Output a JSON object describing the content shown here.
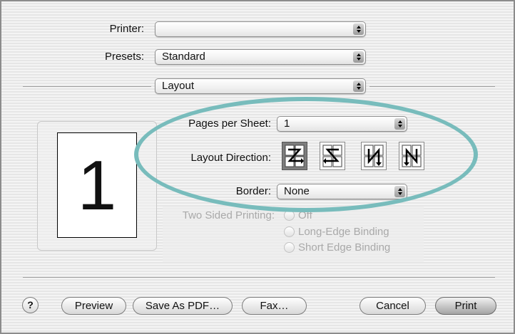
{
  "printer": {
    "label": "Printer:",
    "value": ""
  },
  "presets": {
    "label": "Presets:",
    "value": "Standard"
  },
  "panel_select": {
    "value": "Layout"
  },
  "preview": {
    "page_number": "1"
  },
  "layout": {
    "pages_per_sheet": {
      "label": "Pages per Sheet:",
      "value": "1"
    },
    "direction": {
      "label": "Layout Direction:",
      "options": [
        "z-order",
        "reverse-z-order",
        "n-order",
        "reverse-n-order"
      ],
      "selected_index": 0
    },
    "border": {
      "label": "Border:",
      "value": "None"
    }
  },
  "two_sided": {
    "label": "Two Sided Printing:",
    "options": [
      "Off",
      "Long-Edge Binding",
      "Short Edge Binding"
    ],
    "enabled": false
  },
  "buttons": {
    "help": "?",
    "preview": "Preview",
    "save_pdf": "Save As PDF…",
    "fax": "Fax…",
    "cancel": "Cancel",
    "print": "Print"
  },
  "colors": {
    "highlight": "#78bcbc",
    "window": "#ececec"
  }
}
